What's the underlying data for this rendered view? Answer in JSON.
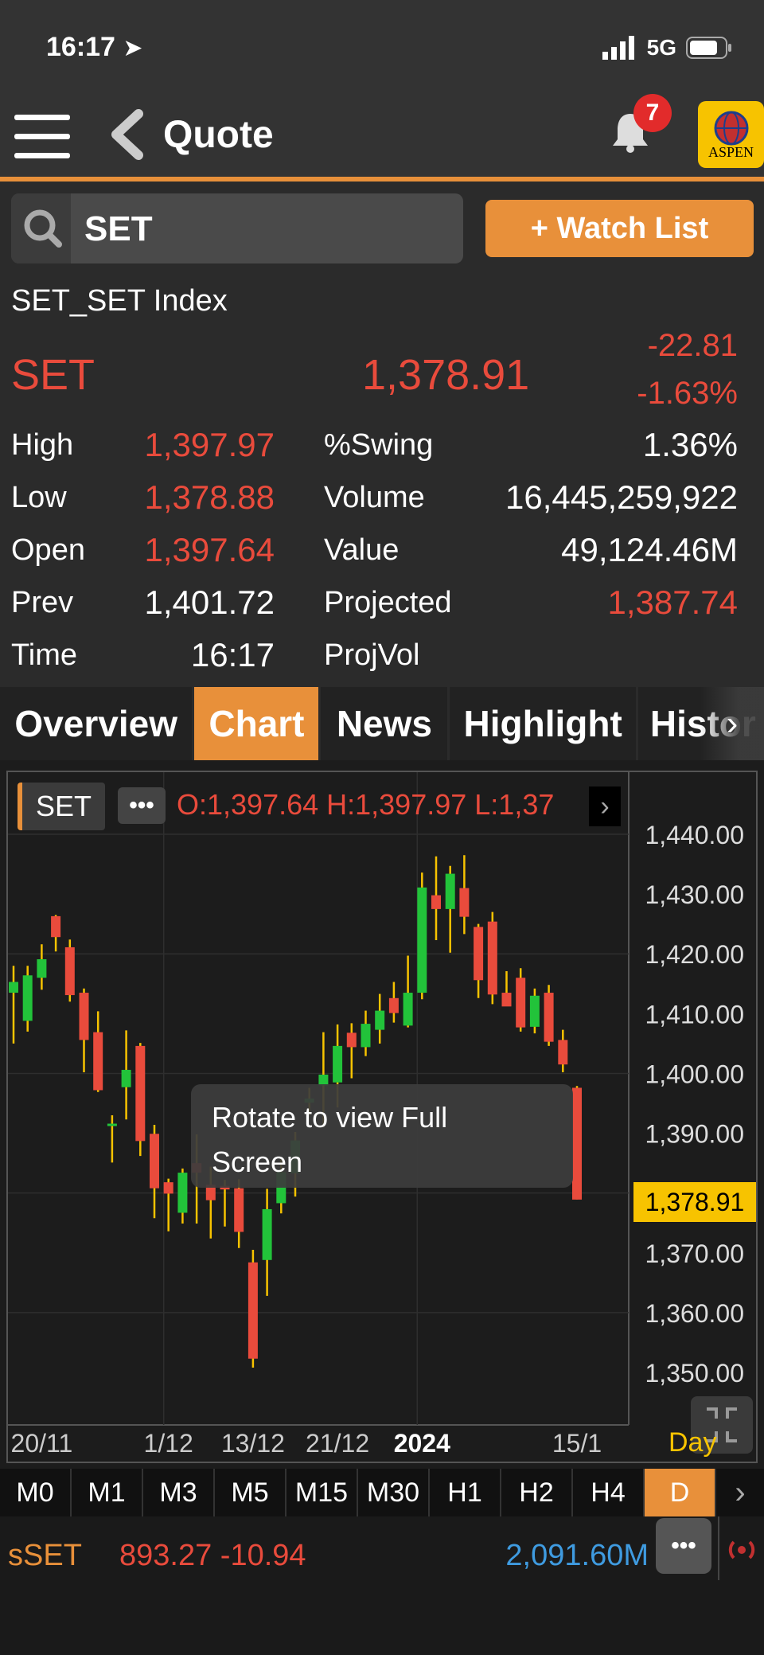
{
  "status_bar": {
    "time": "16:17",
    "network": "5G"
  },
  "header": {
    "title": "Quote",
    "notification_count": "7",
    "logo_text": "ASPEN"
  },
  "search": {
    "value": "SET",
    "watch_button": "+ Watch List"
  },
  "quote": {
    "index_name": "SET_SET Index",
    "symbol": "SET",
    "last": "1,378.91",
    "change": "-22.81",
    "change_pct": "-1.63%",
    "stats": [
      {
        "label": "High",
        "value": "1,397.97",
        "color": "#e94b3c",
        "label2": "%Swing",
        "value2": "1.36%",
        "color2": "#ffffff"
      },
      {
        "label": "Low",
        "value": "1,378.88",
        "color": "#e94b3c",
        "label2": "Volume",
        "value2": "16,445,259,922",
        "color2": "#ffffff"
      },
      {
        "label": "Open",
        "value": "1,397.64",
        "color": "#e94b3c",
        "label2": "Value",
        "value2": "49,124.46M",
        "color2": "#ffffff"
      },
      {
        "label": "Prev",
        "value": "1,401.72",
        "color": "#ffffff",
        "label2": "Projected",
        "value2": "1,387.74",
        "color2": "#e94b3c"
      },
      {
        "label": "Time",
        "value": "16:17",
        "color": "#ffffff",
        "label2": "ProjVol",
        "value2": "",
        "color2": "#ffffff"
      }
    ]
  },
  "tabs": [
    "Overview",
    "Chart",
    "News",
    "Highlight",
    "Histor"
  ],
  "active_tab": "Chart",
  "chart": {
    "symbol_chip": "SET",
    "more_chip": "•••",
    "ohlc_text": "O:1,397.64  H:1,397.97  L:1,37",
    "tooltip_line1": "Rotate to view Full",
    "tooltip_line2": "Screen",
    "current_price_label": "1,378.91",
    "period_label": "Day"
  },
  "timeframes": [
    "M0",
    "M1",
    "M3",
    "M5",
    "M15",
    "M30",
    "H1",
    "H2",
    "H4",
    "D"
  ],
  "active_timeframe": "D",
  "ticker": {
    "symbol": "sSET",
    "price_change": "893.27 -10.94",
    "value": "2,091.60M"
  },
  "colors": {
    "accent": "#e8903a",
    "down": "#e94b3c",
    "up": "#22c33a",
    "highlight": "#f7c300",
    "blue": "#3f9be0"
  },
  "chart_data": {
    "type": "candlestick",
    "y_ticks": [
      1440,
      1430,
      1420,
      1410,
      1400,
      1390,
      1370,
      1360,
      1350
    ],
    "y_tick_labels": [
      "1,440.00",
      "1,430.00",
      "1,420.00",
      "1,410.00",
      "1,400.00",
      "1,390.00",
      "1,370.00",
      "1,360.00",
      "1,350.00"
    ],
    "ylim": [
      1346,
      1444
    ],
    "x_labels": [
      {
        "text": "20/11",
        "index": 2
      },
      {
        "text": "1/12",
        "index": 11
      },
      {
        "text": "13/12",
        "index": 17
      },
      {
        "text": "21/12",
        "index": 23
      },
      {
        "text": "2024",
        "index": 29
      },
      {
        "text": "15/1",
        "index": 40
      }
    ],
    "candles": [
      {
        "o": 1413.5,
        "h": 1418.0,
        "l": 1405.0,
        "c": 1415.3
      },
      {
        "o": 1408.8,
        "h": 1418.0,
        "l": 1407.0,
        "c": 1416.4
      },
      {
        "o": 1416.0,
        "h": 1421.6,
        "l": 1414.0,
        "c": 1419.1
      },
      {
        "o": 1426.3,
        "h": 1426.5,
        "l": 1420.4,
        "c": 1422.8
      },
      {
        "o": 1421.1,
        "h": 1422.4,
        "l": 1412.0,
        "c": 1413.1
      },
      {
        "o": 1413.5,
        "h": 1414.2,
        "l": 1400.2,
        "c": 1405.6
      },
      {
        "o": 1406.9,
        "h": 1410.4,
        "l": 1396.9,
        "c": 1397.2
      },
      {
        "o": 1391.3,
        "h": 1393.0,
        "l": 1385.1,
        "c": 1391.6
      },
      {
        "o": 1397.7,
        "h": 1407.2,
        "l": 1392.3,
        "c": 1400.6
      },
      {
        "o": 1404.6,
        "h": 1405.1,
        "l": 1386.2,
        "c": 1388.7
      },
      {
        "o": 1389.9,
        "h": 1391.4,
        "l": 1375.8,
        "c": 1380.8
      },
      {
        "o": 1381.8,
        "h": 1382.4,
        "l": 1373.6,
        "c": 1379.9
      },
      {
        "o": 1376.7,
        "h": 1384.1,
        "l": 1374.9,
        "c": 1383.4
      },
      {
        "o": 1385.0,
        "h": 1389.8,
        "l": 1374.9,
        "c": 1383.4
      },
      {
        "o": 1381.4,
        "h": 1384.4,
        "l": 1372.4,
        "c": 1378.8
      },
      {
        "o": 1381.2,
        "h": 1382.2,
        "l": 1374.4,
        "c": 1380.6
      },
      {
        "o": 1380.8,
        "h": 1382.3,
        "l": 1370.8,
        "c": 1373.5
      },
      {
        "o": 1368.4,
        "h": 1370.5,
        "l": 1350.8,
        "c": 1352.3
      },
      {
        "o": 1368.8,
        "h": 1380.7,
        "l": 1362.8,
        "c": 1377.3
      },
      {
        "o": 1378.3,
        "h": 1385.6,
        "l": 1376.6,
        "c": 1383.5
      },
      {
        "o": 1383.3,
        "h": 1390.2,
        "l": 1379.4,
        "c": 1388.8
      },
      {
        "o": 1395.1,
        "h": 1397.6,
        "l": 1393.0,
        "c": 1395.8
      },
      {
        "o": 1398.0,
        "h": 1406.9,
        "l": 1391.0,
        "c": 1399.8
      },
      {
        "o": 1398.5,
        "h": 1408.2,
        "l": 1394.3,
        "c": 1404.6
      },
      {
        "o": 1406.8,
        "h": 1408.4,
        "l": 1399.2,
        "c": 1404.4
      },
      {
        "o": 1404.4,
        "h": 1410.5,
        "l": 1402.9,
        "c": 1408.3
      },
      {
        "o": 1407.3,
        "h": 1413.3,
        "l": 1405.0,
        "c": 1410.5
      },
      {
        "o": 1412.6,
        "h": 1415.3,
        "l": 1408.5,
        "c": 1410.1
      },
      {
        "o": 1408.0,
        "h": 1419.7,
        "l": 1407.7,
        "c": 1413.5
      },
      {
        "o": 1413.5,
        "h": 1433.6,
        "l": 1412.4,
        "c": 1431.1
      },
      {
        "o": 1429.8,
        "h": 1436.3,
        "l": 1422.3,
        "c": 1427.5
      },
      {
        "o": 1427.5,
        "h": 1434.7,
        "l": 1420.2,
        "c": 1433.4
      },
      {
        "o": 1431.0,
        "h": 1436.5,
        "l": 1423.3,
        "c": 1426.2
      },
      {
        "o": 1424.5,
        "h": 1425.0,
        "l": 1412.6,
        "c": 1415.6
      },
      {
        "o": 1425.4,
        "h": 1427.0,
        "l": 1411.6,
        "c": 1413.2
      },
      {
        "o": 1413.5,
        "h": 1417.1,
        "l": 1411.8,
        "c": 1411.2
      },
      {
        "o": 1416.0,
        "h": 1417.6,
        "l": 1407.0,
        "c": 1407.7
      },
      {
        "o": 1407.8,
        "h": 1414.2,
        "l": 1406.7,
        "c": 1413.0
      },
      {
        "o": 1413.5,
        "h": 1414.8,
        "l": 1404.6,
        "c": 1405.3
      },
      {
        "o": 1405.6,
        "h": 1407.3,
        "l": 1400.2,
        "c": 1401.5
      },
      {
        "o": 1397.6,
        "h": 1397.9,
        "l": 1378.9,
        "c": 1378.9
      }
    ]
  }
}
